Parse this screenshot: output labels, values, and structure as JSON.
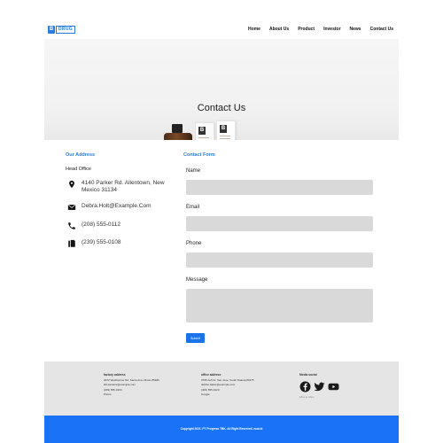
{
  "nav": {
    "logo_letter": "B",
    "logo_text": "DRUG",
    "items": [
      "Home",
      "About Us",
      "Product",
      "Investor",
      "News",
      "Contact Us"
    ]
  },
  "hero": {
    "title": "Contact Us",
    "box_letter": "B"
  },
  "address": {
    "title": "Our Address",
    "head": "Head Office",
    "location": "4140 Parker Rd. Allentown, New Mexico 31134",
    "email": "Debra.Holt@Example.Com",
    "phone": "(208) 555-0112",
    "fax": "(239) 555-0108"
  },
  "form": {
    "title": "Contact Form",
    "name_label": "Name",
    "email_label": "Email",
    "phone_label": "Phone",
    "message_label": "Message",
    "submit_label": "Submit"
  },
  "footer": {
    "factory": {
      "title": "factory address",
      "lines": [
        "2972 Westheimer Rd. Santa Ana, Illinois 85486",
        "bill.sanders@example.com",
        "(209) 555-0104",
        "Phone"
      ]
    },
    "office": {
      "title": "office address",
      "lines": [
        "3795 Ash Dr. San Jose, South Dakota 83475",
        "debbie.baker@example.com",
        "(406) 555-0120",
        "Google"
      ]
    },
    "social": {
      "title": "Media social",
      "note": "follow us online"
    },
    "copyright": "Copyright 2021. PT Progress TBK. All Right Reserved. nuw.id"
  },
  "colors": {
    "accent": "#2a7bde",
    "footer_bar": "#1a73f6",
    "input_bg": "#d9d9d9"
  }
}
